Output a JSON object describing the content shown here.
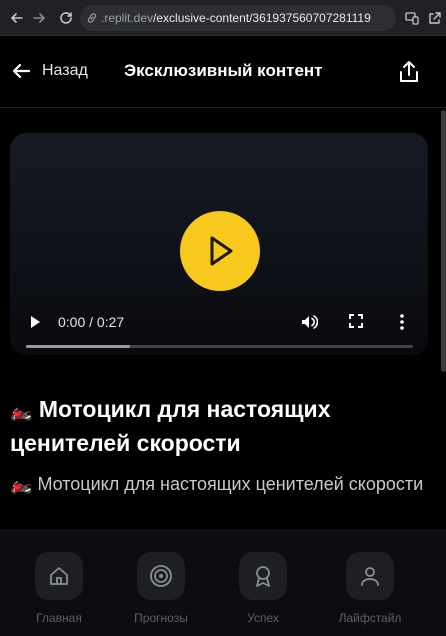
{
  "browser": {
    "url_domain": ".replit.dev",
    "url_path": "/exclusive-content/361937560707281119"
  },
  "header": {
    "back_label": "Назад",
    "title": "Эксклюзивный контент"
  },
  "video": {
    "time": "0:00 / 0:27",
    "progress": 0.27
  },
  "post": {
    "title": "Мотоцикл для настоящих ценителей скорости",
    "title_emoji": "🏍️",
    "description": "Мотоцикл для настоящих ценителей скорости",
    "description_emoji": "🏍️"
  },
  "nav": [
    {
      "label": "Главная",
      "icon": "home-icon"
    },
    {
      "label": "Прогнозы",
      "icon": "target-icon"
    },
    {
      "label": "Успех",
      "icon": "award-icon"
    },
    {
      "label": "Лайфстайл",
      "icon": "user-icon"
    }
  ],
  "colors": {
    "accent": "#f7c81d",
    "background": "#000000"
  }
}
